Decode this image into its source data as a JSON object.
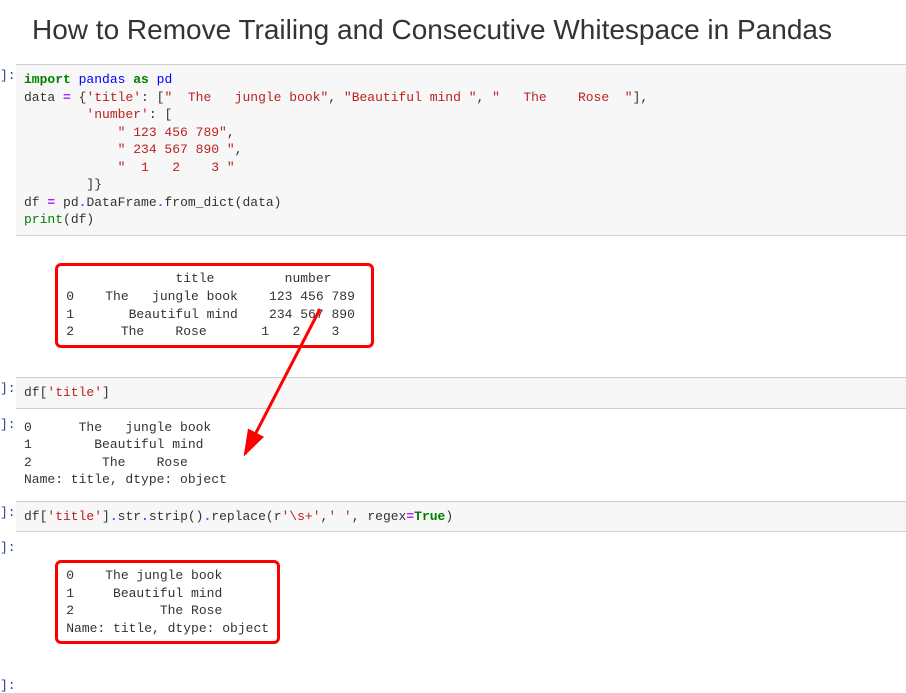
{
  "title": "How to Remove Trailing and Consecutive Whitespace in Pandas",
  "prompts": {
    "in": "]:",
    "out": "]:"
  },
  "cells": {
    "c1_code": {
      "l1_kw1": "import",
      "l1_nn": "pandas",
      "l1_kw2": "as",
      "l1_alias": "pd",
      "l2_a": "data ",
      "l2_op": "=",
      "l2_b": " {",
      "l2_s1": "'title'",
      "l2_c": ": [",
      "l2_s2": "\"  The   jungle book\"",
      "l2_d": ", ",
      "l2_s3": "\"Beautiful mind \"",
      "l2_e": ", ",
      "l2_s4": "\"   The    Rose  \"",
      "l2_f": "],",
      "l3_a": "        ",
      "l3_s1": "'number'",
      "l3_b": ": [",
      "l4_a": "            ",
      "l4_s": "\" 123 456 789\"",
      "l4_b": ",",
      "l5_a": "            ",
      "l5_s": "\" 234 567 890 \"",
      "l5_b": ",",
      "l6_a": "            ",
      "l6_s": "\"  1   2    3 \"",
      "l7": "        ]}",
      "l8_a": "df ",
      "l8_op": "=",
      "l8_b1": " pd",
      "l8_op2": ".",
      "l8_b2": "DataFrame",
      "l8_op3": ".",
      "l8_b3": "from_dict(data)",
      "l9_fn": "print",
      "l9_b": "(df)"
    },
    "c1_out": "              title         number\n0    The   jungle book    123 456 789\n1       Beautiful mind    234 567 890 \n2      The    Rose       1   2    3 ",
    "c2_code": {
      "a": "df[",
      "s": "'title'",
      "b": "]"
    },
    "c2_out": "0      The   jungle book\n1        Beautiful mind \n2         The    Rose  \nName: title, dtype: object",
    "c3_code": {
      "a": "df[",
      "s1": "'title'",
      "b": "]",
      "op1": ".",
      "c": "str",
      "op2": ".",
      "d": "strip()",
      "op3": ".",
      "e": "replace(r",
      "s2": "'\\s+'",
      "f": ",",
      "s3": "' '",
      "g": ", regex",
      "op4": "=",
      "bool": "True",
      "h": ")"
    },
    "c3_out": "0    The jungle book\n1     Beautiful mind\n2           The Rose\nName: title, dtype: object"
  }
}
